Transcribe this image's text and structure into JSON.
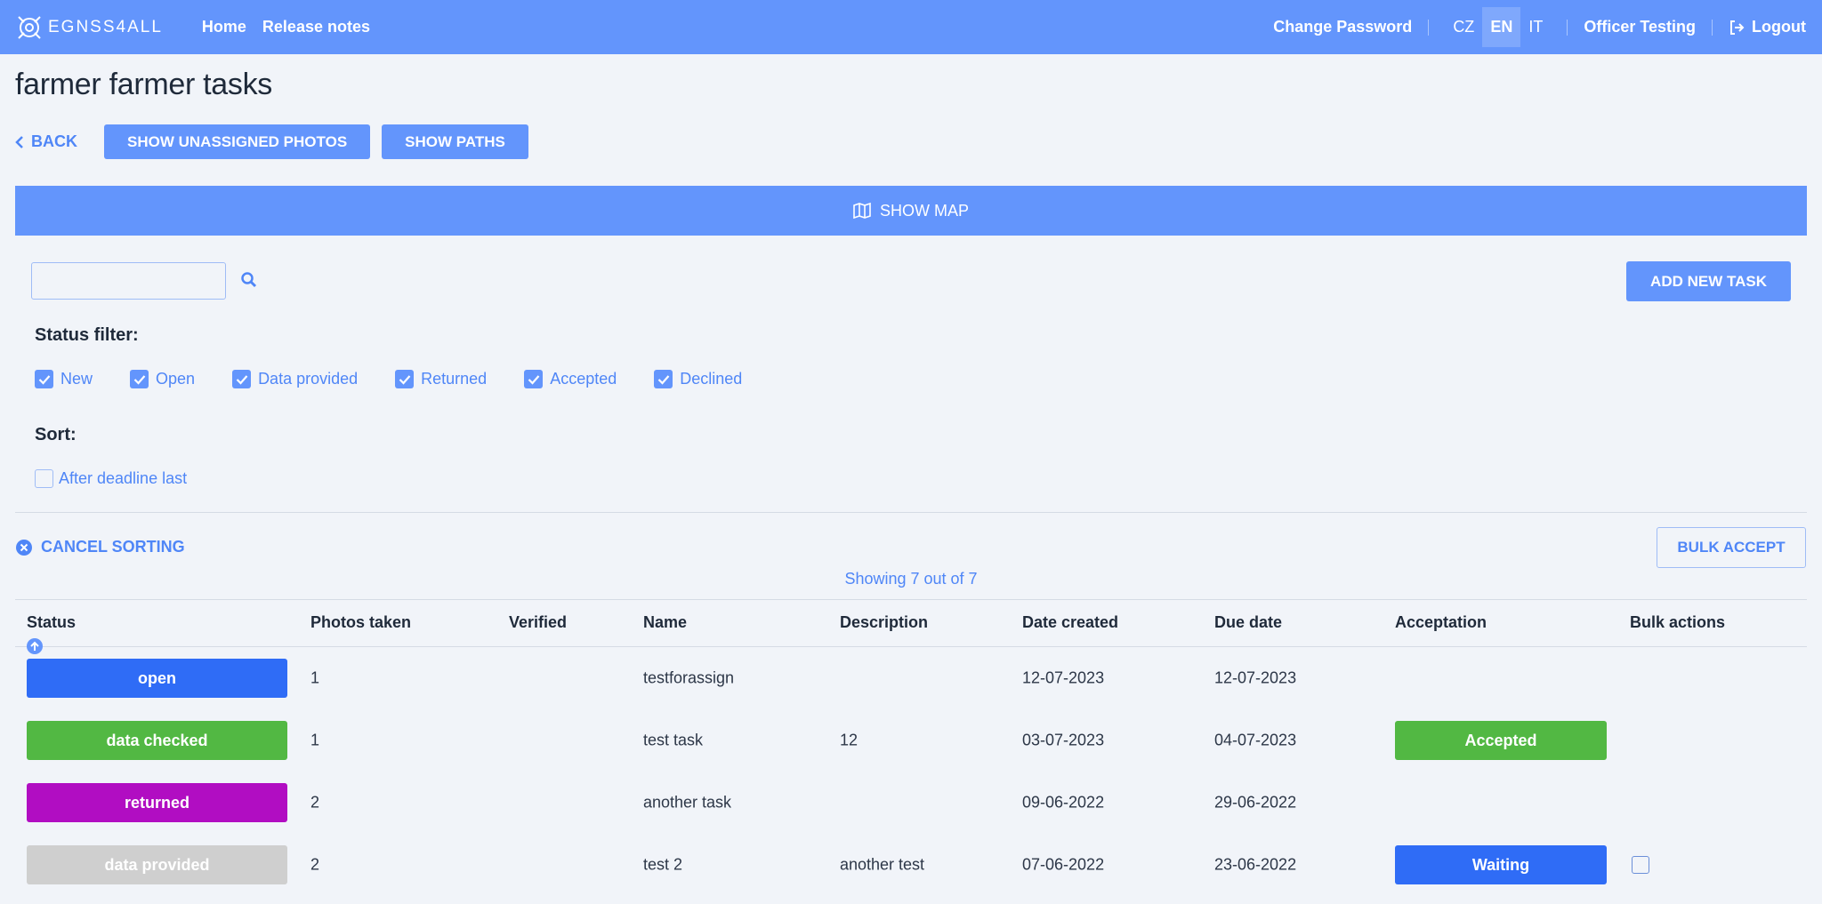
{
  "header": {
    "logo_text": "EGNSS4ALL",
    "nav": [
      "Home",
      "Release notes"
    ],
    "change_password": "Change Password",
    "languages": [
      "CZ",
      "EN",
      "IT"
    ],
    "active_language": "EN",
    "user": "Officer Testing",
    "logout": "Logout"
  },
  "page": {
    "title": "farmer farmer tasks",
    "back": "BACK",
    "show_unassigned": "SHOW UNASSIGNED PHOTOS",
    "show_paths": "SHOW PATHS",
    "show_map": "SHOW MAP",
    "search_placeholder": "",
    "add_new_task": "ADD NEW TASK"
  },
  "status_filter": {
    "label": "Status filter:",
    "options": [
      {
        "label": "New",
        "checked": true
      },
      {
        "label": "Open",
        "checked": true
      },
      {
        "label": "Data provided",
        "checked": true
      },
      {
        "label": "Returned",
        "checked": true
      },
      {
        "label": "Accepted",
        "checked": true
      },
      {
        "label": "Declined",
        "checked": true
      }
    ]
  },
  "sort": {
    "label": "Sort:",
    "after_deadline_last": "After deadline last",
    "cancel_sorting": "CANCEL SORTING",
    "bulk_accept": "BULK ACCEPT",
    "showing": "Showing 7 out of 7"
  },
  "table": {
    "columns": [
      "Status",
      "Photos taken",
      "Verified",
      "Name",
      "Description",
      "Date created",
      "Due date",
      "Acceptation",
      "Bulk actions"
    ],
    "rows": [
      {
        "status": "open",
        "status_color": "#2f6cf6",
        "photos": "1",
        "verified": "",
        "name": "testforassign",
        "description": "",
        "created": "12-07-2023",
        "due": "12-07-2023",
        "acceptation": "",
        "acceptation_color": "",
        "bulk": false
      },
      {
        "status": "data checked",
        "status_color": "#52b843",
        "photos": "1",
        "verified": "",
        "name": "test task",
        "description": "12",
        "created": "03-07-2023",
        "due": "04-07-2023",
        "acceptation": "Accepted",
        "acceptation_color": "#52b843",
        "bulk": false
      },
      {
        "status": "returned",
        "status_color": "#b10dc2",
        "photos": "2",
        "verified": "",
        "name": "another task",
        "description": "",
        "created": "09-06-2022",
        "due": "29-06-2022",
        "acceptation": "",
        "acceptation_color": "",
        "bulk": false
      },
      {
        "status": "data provided",
        "status_color": "#cfcfcf",
        "photos": "2",
        "verified": "",
        "name": "test 2",
        "description": "another test",
        "created": "07-06-2022",
        "due": "23-06-2022",
        "acceptation": "Waiting",
        "acceptation_color": "#2f6cf6",
        "bulk": true
      }
    ]
  },
  "colors": {
    "primary": "#6395fc",
    "link": "#4f86f7",
    "background": "#f1f4f9"
  }
}
